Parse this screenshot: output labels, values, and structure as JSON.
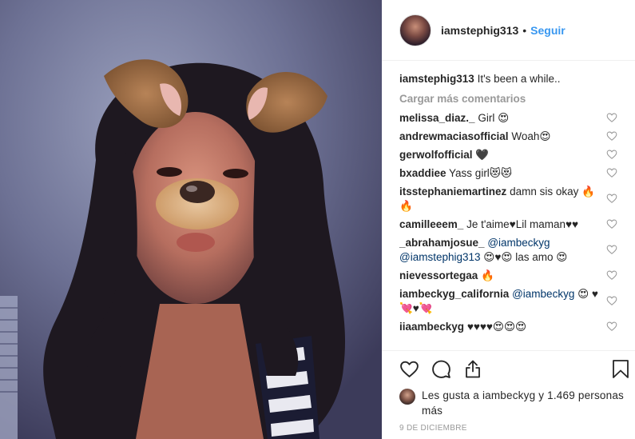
{
  "post": {
    "username": "iamstephig313",
    "follow_label": "Seguir",
    "dot": "•",
    "caption_text": "It's been a while.."
  },
  "load_more": "Cargar más comentarios",
  "comments": [
    {
      "user": "melissa_diaz._",
      "text": "Girl 😍"
    },
    {
      "user": "andrewmaciasofficial",
      "text": "Woah😍"
    },
    {
      "user": "gerwolfofficial",
      "text": "🖤"
    },
    {
      "user": "bxaddiee",
      "text": "Yass girl😻😻"
    },
    {
      "user": "itsstephaniemartinez",
      "text": "damn sis okay 🔥 🔥"
    },
    {
      "user": "camilleeem_",
      "text": "Je t'aime♥Lil maman♥♥"
    },
    {
      "user": "_abrahamjosue_",
      "mention1": "@iambeckyg",
      "mention2": "@iamstephig313",
      "text": "😍♥😍 las amo 😍"
    },
    {
      "user": "nievessortegaa",
      "text": "🔥"
    },
    {
      "user": "iambeckyg_california",
      "mention1": "@iambeckyg",
      "text": "😍 ♥💘♥💘"
    },
    {
      "user": "iiaambeckyg",
      "text": "♥♥♥♥😍😍😍"
    }
  ],
  "likes_text": "Les gusta a iambeckyg y 1.469 personas más",
  "date": "9 DE DICIEMBRE",
  "icons": {
    "like": "heart-outline-icon",
    "comment": "speech-bubble-icon",
    "share": "share-upload-icon",
    "save": "bookmark-icon",
    "comment_like": "small-heart-icon"
  },
  "colors": {
    "link": "#3897f0",
    "mention": "#003569",
    "muted": "#999999",
    "text": "#262626"
  }
}
